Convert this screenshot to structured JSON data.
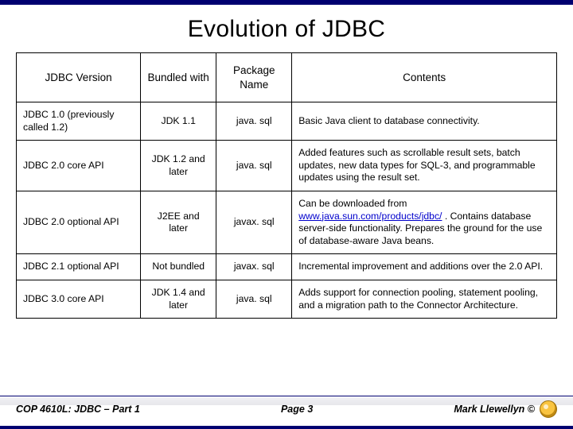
{
  "title": "Evolution of JDBC",
  "headers": {
    "version": "JDBC Version",
    "bundled": "Bundled with",
    "package": "Package Name",
    "contents": "Contents"
  },
  "rows": [
    {
      "version": "JDBC 1.0 (previously called 1.2)",
      "bundled": "JDK 1.1",
      "package": "java. sql",
      "contents": "Basic Java client to database connectivity."
    },
    {
      "version": "JDBC 2.0 core API",
      "bundled": "JDK 1.2 and later",
      "package": "java. sql",
      "contents": "Added features such as scrollable result sets, batch updates, new data types for SQL-3, and programmable updates using the result set."
    },
    {
      "version": "JDBC 2.0 optional API",
      "bundled": "J2EE and later",
      "package": "javax. sql",
      "contents_pre": "Can be downloaded from ",
      "contents_link": "www.java.sun.com/products/jdbc/",
      "contents_post": " .  Contains database server-side functionality. Prepares the ground for the use of database-aware Java beans."
    },
    {
      "version": "JDBC 2.1 optional API",
      "bundled": "Not bundled",
      "package": "javax. sql",
      "contents": "Incremental improvement and additions over the 2.0 API."
    },
    {
      "version": "JDBC 3.0 core API",
      "bundled": "JDK 1.4 and later",
      "package": "java. sql",
      "contents": "Adds support for connection pooling, statement pooling, and a migration path to the Connector Architecture."
    }
  ],
  "footer": {
    "left": "COP 4610L: JDBC – Part 1",
    "center": "Page 3",
    "right": "Mark Llewellyn ©"
  }
}
